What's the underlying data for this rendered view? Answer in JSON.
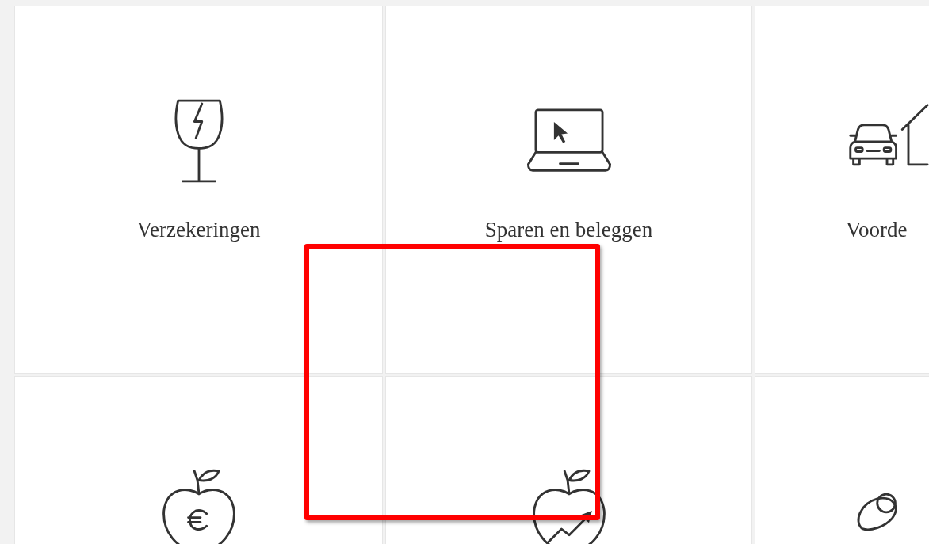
{
  "tiles": [
    {
      "kind": "glass",
      "label": "Verzekeringen"
    },
    {
      "kind": "laptop",
      "label": "Sparen en beleggen"
    },
    {
      "kind": "car-house",
      "label": "Voorde"
    },
    {
      "kind": "apple-euro"
    },
    {
      "kind": "apple-growth"
    },
    {
      "kind": "ring"
    }
  ]
}
